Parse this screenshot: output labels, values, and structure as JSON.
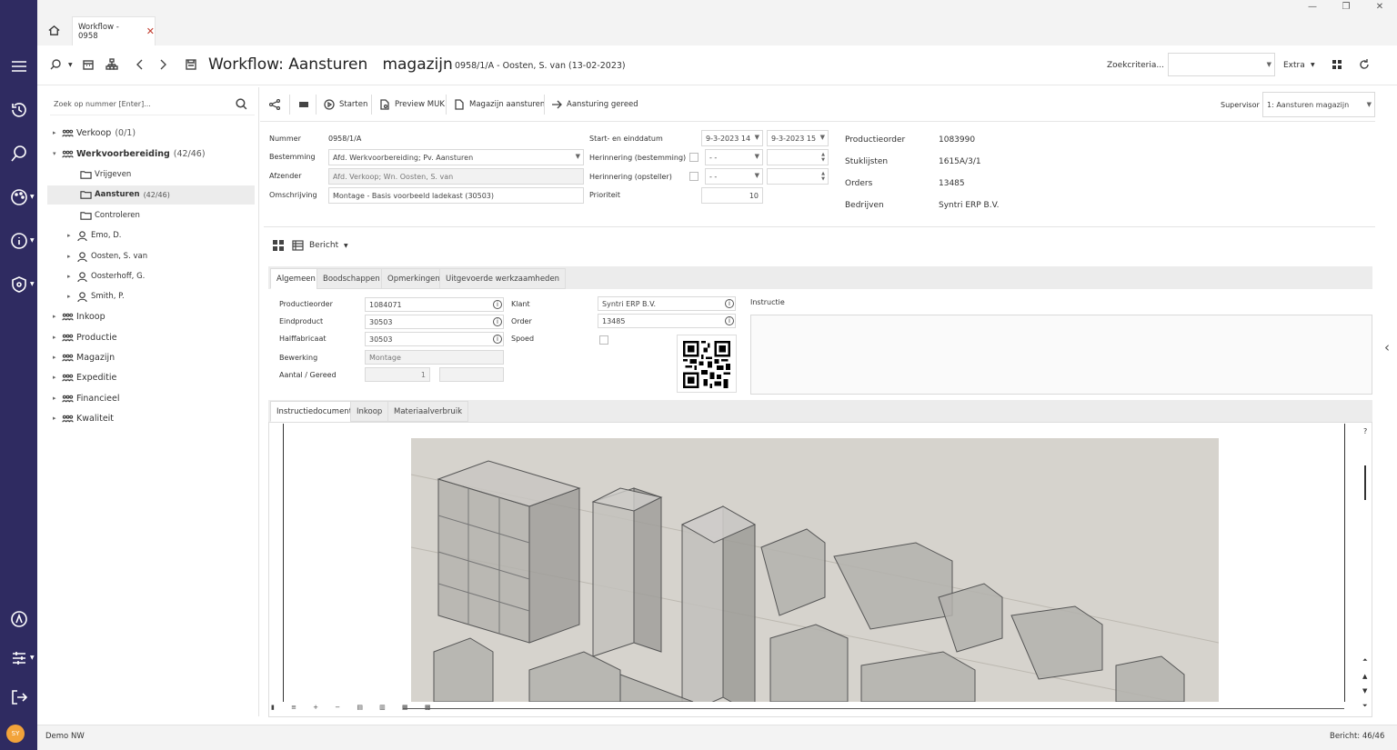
{
  "window": {
    "minimize": "—",
    "restore": "❐",
    "close": "✕"
  },
  "tab": {
    "label": "Workflow - 0958",
    "close": "✕"
  },
  "header": {
    "title": "Workflow: Aansturen   magazijn",
    "subtitle": "0958/1/A - Oosten, S. van (13-02-2023)",
    "zoekcriteria_label": "Zoekcriteria...",
    "extra_label": "Extra"
  },
  "sidebar": {
    "search_placeholder": "Zoek op nummer [Enter]...",
    "items": [
      {
        "label": "Verkoop",
        "count": "(0/1)"
      },
      {
        "label": "Werkvoorbereiding",
        "count": "(42/46)"
      },
      {
        "label": "Vrijgeven"
      },
      {
        "label": "Aansturen",
        "count": "(42/46)"
      },
      {
        "label": "Controleren"
      },
      {
        "label": "Emo, D."
      },
      {
        "label": "Oosten, S. van"
      },
      {
        "label": "Oosterhoff, G."
      },
      {
        "label": "Smith, P."
      },
      {
        "label": "Inkoop"
      },
      {
        "label": "Productie"
      },
      {
        "label": "Magazijn"
      },
      {
        "label": "Expeditie"
      },
      {
        "label": "Financieel"
      },
      {
        "label": "Kwaliteit"
      }
    ]
  },
  "actions": {
    "starten": "Starten",
    "preview": "Preview MUK",
    "magazijn": "Magazijn aansturen",
    "gereed": "Aansturing gereed",
    "supervisor_label": "Supervisor",
    "supervisor_value": "1: Aansturen  magazijn"
  },
  "form": {
    "nummer_label": "Nummer",
    "nummer_value": "0958/1/A",
    "bestemming_label": "Bestemming",
    "bestemming_value": "Afd. Werkvoorbereiding; Pv. Aansturen",
    "afzender_label": "Afzender",
    "afzender_value": "Afd. Verkoop; Wn. Oosten, S. van",
    "omschrijving_label": "Omschrijving",
    "omschrijving_value": "Montage - Basis voorbeeld ladekast (30503)",
    "startend_label": "Start- en einddatum",
    "start_value": "9-3-2023 14",
    "end_value": "9-3-2023 15",
    "herinnering_best_label": "Herinnering (bestemming)",
    "herinnering_opst_label": "Herinnering (opsteller)",
    "dash_value": "- -",
    "prioriteit_label": "Prioriteit",
    "prioriteit_value": "10"
  },
  "info": [
    {
      "label": "Productieorder",
      "value": "1083990"
    },
    {
      "label": "Stuklijsten",
      "value": "1615A/3/1"
    },
    {
      "label": "Orders",
      "value": "13485"
    },
    {
      "label": "Bedrijven",
      "value": "Syntri ERP B.V."
    }
  ],
  "bericht_label": "Bericht",
  "detail_tabs": [
    "Algemeen",
    "Boodschappen",
    "Opmerkingen",
    "Uitgevoerde werkzaamheden"
  ],
  "detail": {
    "productieorder_label": "Productieorder",
    "productieorder_value": "1084071",
    "eindproduct_label": "Eindproduct",
    "eindproduct_value": "30503",
    "halffabricaat_label": "Halffabricaat",
    "halffabricaat_value": "30503",
    "bewerking_label": "Bewerking",
    "bewerking_value": "Montage",
    "aantal_label": "Aantal / Gereed",
    "aantal_value": "1",
    "klant_label": "Klant",
    "klant_value": "Syntri ERP B.V.",
    "order_label": "Order",
    "order_value": "13485",
    "spoed_label": "Spoed",
    "instructie_label": "Instructie"
  },
  "doc_tabs": [
    "Instructiedocument",
    "Inkoop",
    "Materiaalverbruik"
  ],
  "viewer": {
    "help": "?"
  },
  "status": {
    "left": "Demo NW",
    "right": "Bericht: 46/46",
    "avatar": "SY"
  }
}
